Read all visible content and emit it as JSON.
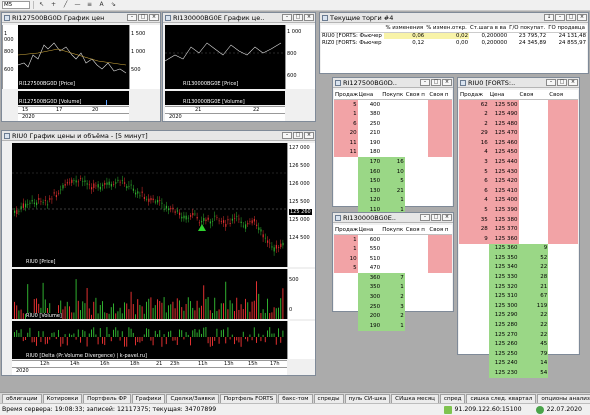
{
  "toolbar": {
    "timeframe": "M5",
    "icons": [
      "arrow-icon",
      "cross-icon",
      "line-icon",
      "hline-icon",
      "fib-icon",
      "text-icon",
      "trend-icon"
    ]
  },
  "win_top_left": {
    "title": "RI127500BG0D График цен",
    "price_scale": [
      "1 500",
      "1 000",
      "500"
    ],
    "left_scale": [
      "1 000",
      "800",
      "600"
    ],
    "price_label": "RI127500BG0D [Price]",
    "vol_label": "RI127500BG0D [Volume]",
    "axis": [
      "15",
      "17",
      "20"
    ],
    "year": "2020"
  },
  "win_top_mid": {
    "title": "RI130000BG0E График це..",
    "price_scale": [
      "1 000",
      "800",
      "600"
    ],
    "price_label": "RI130000BG0E [Price]",
    "vol_label": "RI130000BG0E [Volume]",
    "axis": [
      "21",
      "22"
    ],
    "year": "2020"
  },
  "win_main": {
    "title": "RIU0 График цены и объёма - [5 минут]",
    "price_scale": [
      "127 000",
      "126 500",
      "126 000",
      "125 500",
      "125 000",
      "124 500"
    ],
    "current_price": "125 260",
    "price_label": "RIU0 [Price]",
    "vol_label": "RIU0 [Volume]",
    "delta_label": "RIU0 [Delta (Pr.Volume Divergence) | k-pavel.ru]",
    "vol_scale": [
      "500",
      "0"
    ],
    "axis": [
      "12h",
      "14h",
      "16h",
      "18h",
      "21",
      "23h",
      "11h",
      "13h",
      "15h",
      "17h"
    ],
    "year": "2020"
  },
  "win_trades": {
    "title": "Текущие торги #4",
    "headers": [
      "",
      "% изменения",
      "% измен.откр.",
      "Ст.шага в ва",
      "Г/О покупат.",
      "ГО продавца"
    ],
    "rows": [
      [
        "RIU0 [FORTS: Фьючер",
        "0,06",
        "0,02",
        "0,200000",
        "23 795,72",
        "24 131,48"
      ],
      [
        "RIZ0 [FORTS: Фьючер",
        "0,12",
        "0,00",
        "0,200000",
        "24 345,89",
        "24 855,97"
      ]
    ]
  },
  "book1": {
    "title": "RI127500BG0D..",
    "headers": [
      "Продаж",
      "Цена",
      "Покупк",
      "Своя п",
      "Своя п"
    ],
    "asks": [
      [
        "5",
        "400"
      ],
      [
        "1",
        "380"
      ],
      [
        "6",
        "250"
      ],
      [
        "20",
        "210"
      ],
      [
        "11",
        "190"
      ],
      [
        "11",
        "180"
      ]
    ],
    "bids": [
      [
        "170",
        "16"
      ],
      [
        "160",
        "10"
      ],
      [
        "150",
        "5"
      ],
      [
        "130",
        "21"
      ],
      [
        "120",
        "1"
      ],
      [
        "110",
        "1"
      ]
    ]
  },
  "book2": {
    "title": "RI130000BG0E..",
    "headers": [
      "Продаж",
      "Цена",
      "Покупк",
      "Своя п",
      "Своя п"
    ],
    "asks": [
      [
        "1",
        "600"
      ],
      [
        "1",
        "550"
      ],
      [
        "10",
        "510"
      ],
      [
        "5",
        "470"
      ]
    ],
    "bids": [
      [
        "360",
        "7"
      ],
      [
        "350",
        "1"
      ],
      [
        "300",
        "2"
      ],
      [
        "250",
        "3"
      ],
      [
        "200",
        "2"
      ],
      [
        "190",
        "1"
      ]
    ]
  },
  "book3": {
    "title": "RIU0 [FORTS:..",
    "headers": [
      "Продаж",
      "Цена",
      "Своя",
      "Своя"
    ],
    "asks": [
      [
        "62",
        "125 500"
      ],
      [
        "2",
        "125 490"
      ],
      [
        "2",
        "125 480"
      ],
      [
        "29",
        "125 470"
      ],
      [
        "16",
        "125 460"
      ],
      [
        "4",
        "125 450"
      ],
      [
        "3",
        "125 440"
      ],
      [
        "5",
        "125 430"
      ],
      [
        "6",
        "125 420"
      ],
      [
        "6",
        "125 410"
      ],
      [
        "4",
        "125 400"
      ],
      [
        "5",
        "125 390"
      ],
      [
        "35",
        "125 380"
      ],
      [
        "28",
        "125 370"
      ],
      [
        "9",
        "125 360"
      ]
    ],
    "bids": [
      [
        "125 360",
        "9"
      ],
      [
        "125 350",
        "52"
      ],
      [
        "125 340",
        "22"
      ],
      [
        "125 330",
        "28"
      ],
      [
        "125 320",
        "21"
      ],
      [
        "125 310",
        "67"
      ],
      [
        "125 300",
        "119"
      ],
      [
        "125 290",
        "22"
      ],
      [
        "125 280",
        "22"
      ],
      [
        "125 270",
        "22"
      ],
      [
        "125 260",
        "45"
      ],
      [
        "125 250",
        "79"
      ],
      [
        "125 240",
        "14"
      ],
      [
        "125 230",
        "54"
      ]
    ]
  },
  "tabs": [
    "облигации",
    "Котировки",
    "Портфель ФР",
    "Графики",
    "Сделки/Заявки",
    "Портфель FORTS",
    "бакс-том",
    "спреды",
    "пуль СИ-шка",
    "СИшка месяц",
    "спред",
    "сишка след. квартал",
    "опционы анализ",
    "опционы РТС",
    "нефть"
  ],
  "active_tab": "опционы РТС",
  "status": {
    "server_time": "Время сервера: 19:08:33; записей: 12117375; текущая: 34707899",
    "ip": "91.209.122.60:15100",
    "date": "22.07.2020"
  },
  "colors": {
    "ask_bg": "#f2a3a6",
    "bid_bg": "#9ad786",
    "chart_bg": "#000000",
    "candle_up": "#2fae2f",
    "candle_down": "#e03030"
  }
}
